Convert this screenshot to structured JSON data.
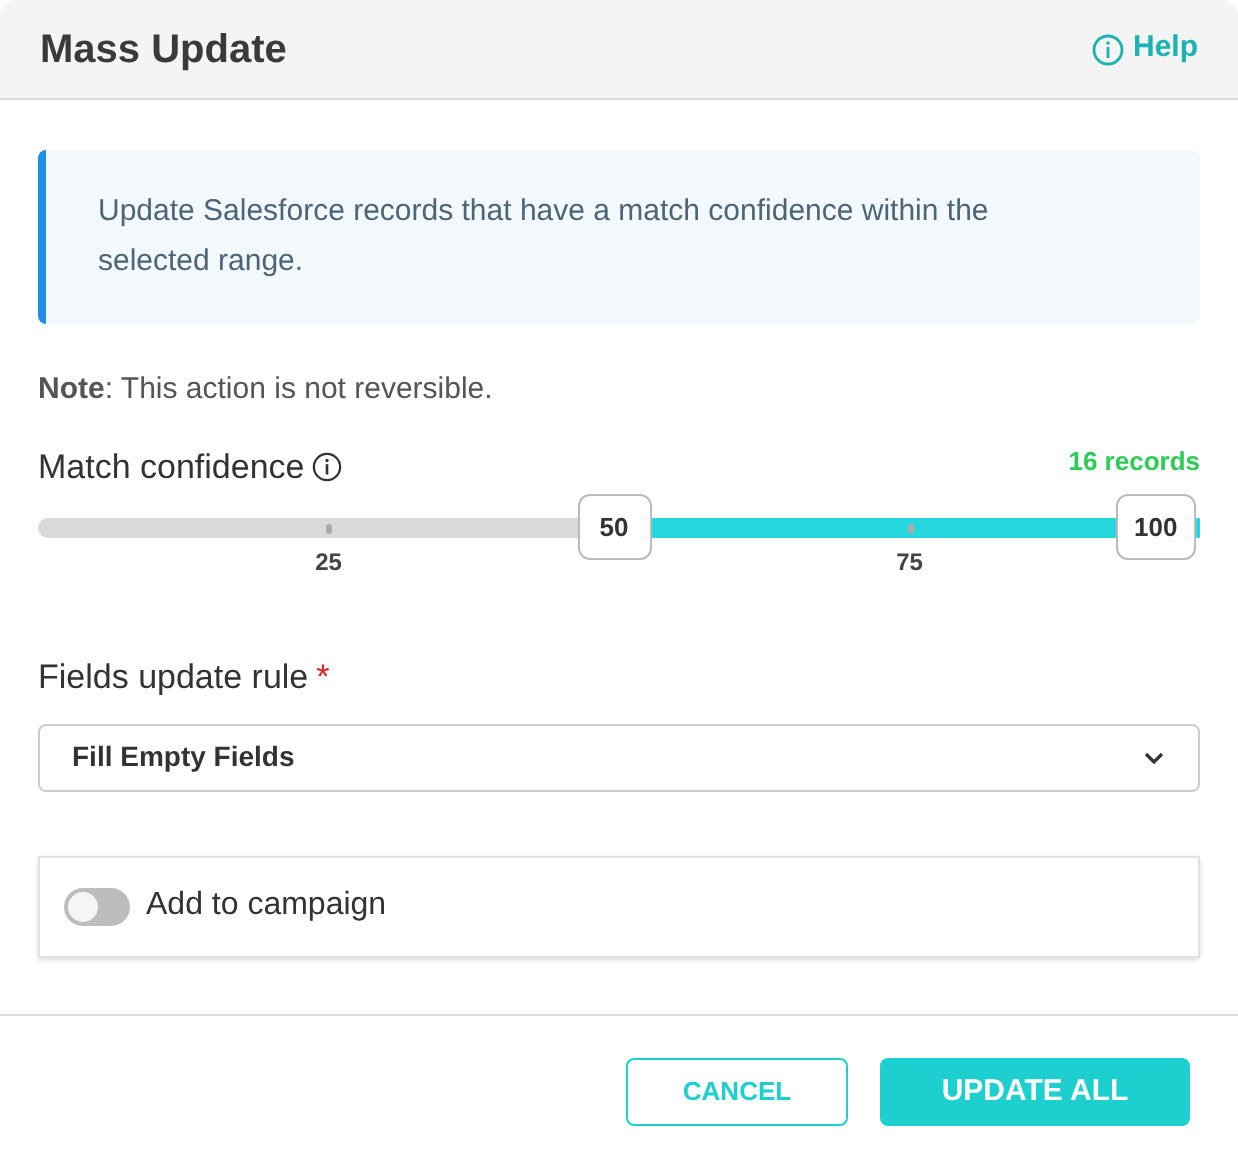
{
  "dialog": {
    "title": "Mass Update",
    "help_link": "Help"
  },
  "info": "Update Salesforce records that have a match confidence within the selected range.",
  "note": "**Note**: This action is not reversible.",
  "confidence": {
    "label": "Match confidence",
    "count": "16 records",
    "thumbs": [
      {
        "label": "50",
        "level": 0.5
      },
      {
        "label": "100",
        "level": 1
      }
    ],
    "ticks": [
      {
        "label": "25",
        "level": 0.25
      },
      {
        "label": "75",
        "level": 0.75
      }
    ]
  },
  "rule": {
    "label": "Fields update rule",
    "required": true,
    "required_mark": "*",
    "value": "Fill Empty Fields"
  },
  "campaign": {
    "label": "Add to campaign",
    "on": false
  },
  "buttons": [
    {
      "label": "CANCEL",
      "kind": "outline"
    },
    {
      "label": "UPDATE ALL",
      "kind": "primary"
    }
  ]
}
